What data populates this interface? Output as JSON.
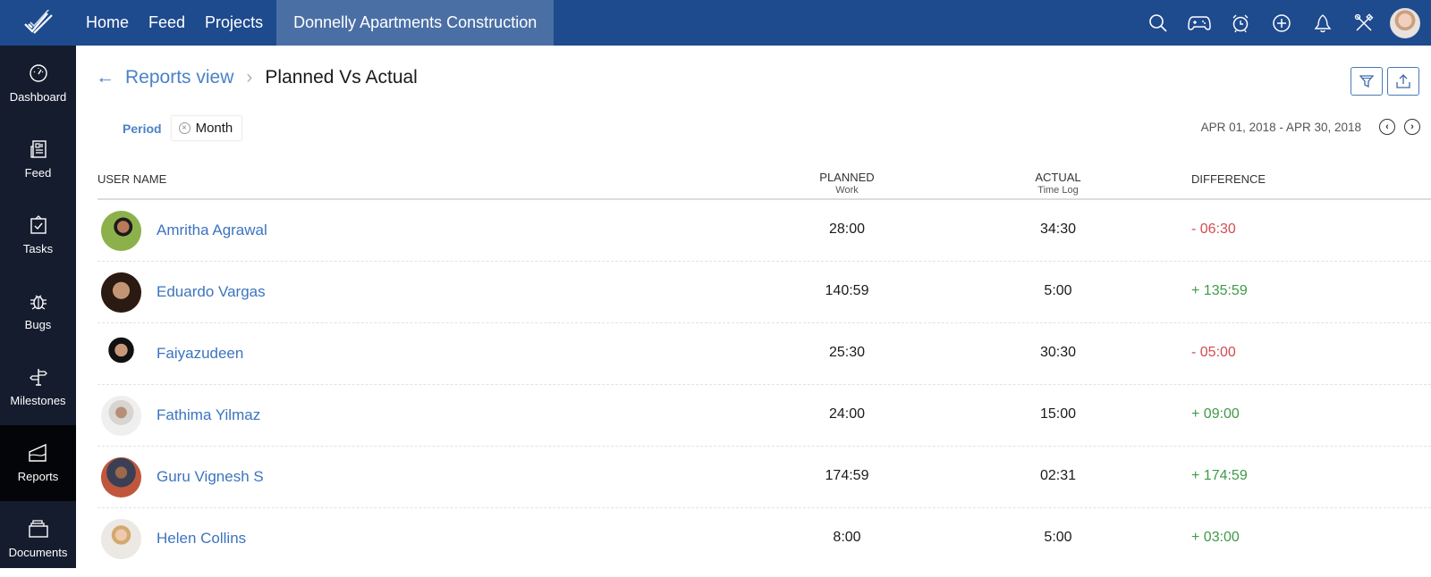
{
  "topbar": {
    "nav": [
      "Home",
      "Feed",
      "Projects"
    ],
    "active_project": "Donnelly Apartments Construction",
    "icons": [
      "search-icon",
      "gamepad-icon",
      "alarm-clock-icon",
      "plus-circle-icon",
      "bell-icon",
      "tools-icon",
      "user-avatar"
    ]
  },
  "sidebar": {
    "items": [
      {
        "label": "Dashboard",
        "icon": "dashboard-gauge-icon"
      },
      {
        "label": "Feed",
        "icon": "feed-newspaper-icon"
      },
      {
        "label": "Tasks",
        "icon": "tasks-clipboard-icon"
      },
      {
        "label": "Bugs",
        "icon": "bug-icon"
      },
      {
        "label": "Milestones",
        "icon": "signpost-icon"
      },
      {
        "label": "Reports",
        "icon": "reports-chart-icon",
        "active": true
      },
      {
        "label": "Documents",
        "icon": "documents-folder-icon"
      }
    ]
  },
  "breadcrumb": {
    "back": "←",
    "parent": "Reports view",
    "separator": "›",
    "current": "Planned Vs Actual"
  },
  "filter": {
    "label": "Period",
    "chip": "Month",
    "chip_remove": "×"
  },
  "date_range": {
    "text": "APR 01, 2018 - APR 30, 2018",
    "prev": "‹",
    "next": "›"
  },
  "actions": {
    "filter": "filter-icon",
    "export": "export-icon"
  },
  "table": {
    "headers": {
      "user": "USER NAME",
      "planned": "PLANNED",
      "planned_sub": "Work",
      "actual": "ACTUAL",
      "actual_sub": "Time Log",
      "difference": "DIFFERENCE"
    },
    "rows": [
      {
        "name": "Amritha Agrawal",
        "planned": "28:00",
        "actual": "34:30",
        "difference": "- 06:30",
        "sign": "neg"
      },
      {
        "name": "Eduardo Vargas",
        "planned": "140:59",
        "actual": "5:00",
        "difference": "+ 135:59",
        "sign": "pos"
      },
      {
        "name": "Faiyazudeen",
        "planned": "25:30",
        "actual": "30:30",
        "difference": "- 05:00",
        "sign": "neg"
      },
      {
        "name": "Fathima Yilmaz",
        "planned": "24:00",
        "actual": "15:00",
        "difference": "+ 09:00",
        "sign": "pos"
      },
      {
        "name": "Guru Vignesh S",
        "planned": "174:59",
        "actual": "02:31",
        "difference": "+ 174:59",
        "sign": "pos"
      },
      {
        "name": "Helen Collins",
        "planned": "8:00",
        "actual": "5:00",
        "difference": "+ 03:00",
        "sign": "pos"
      }
    ]
  },
  "colors": {
    "topbar": "#1e4a8e",
    "sidebar": "#151c2e",
    "link": "#3c74bf",
    "negative": "#d24c52",
    "positive": "#3e9b47"
  }
}
